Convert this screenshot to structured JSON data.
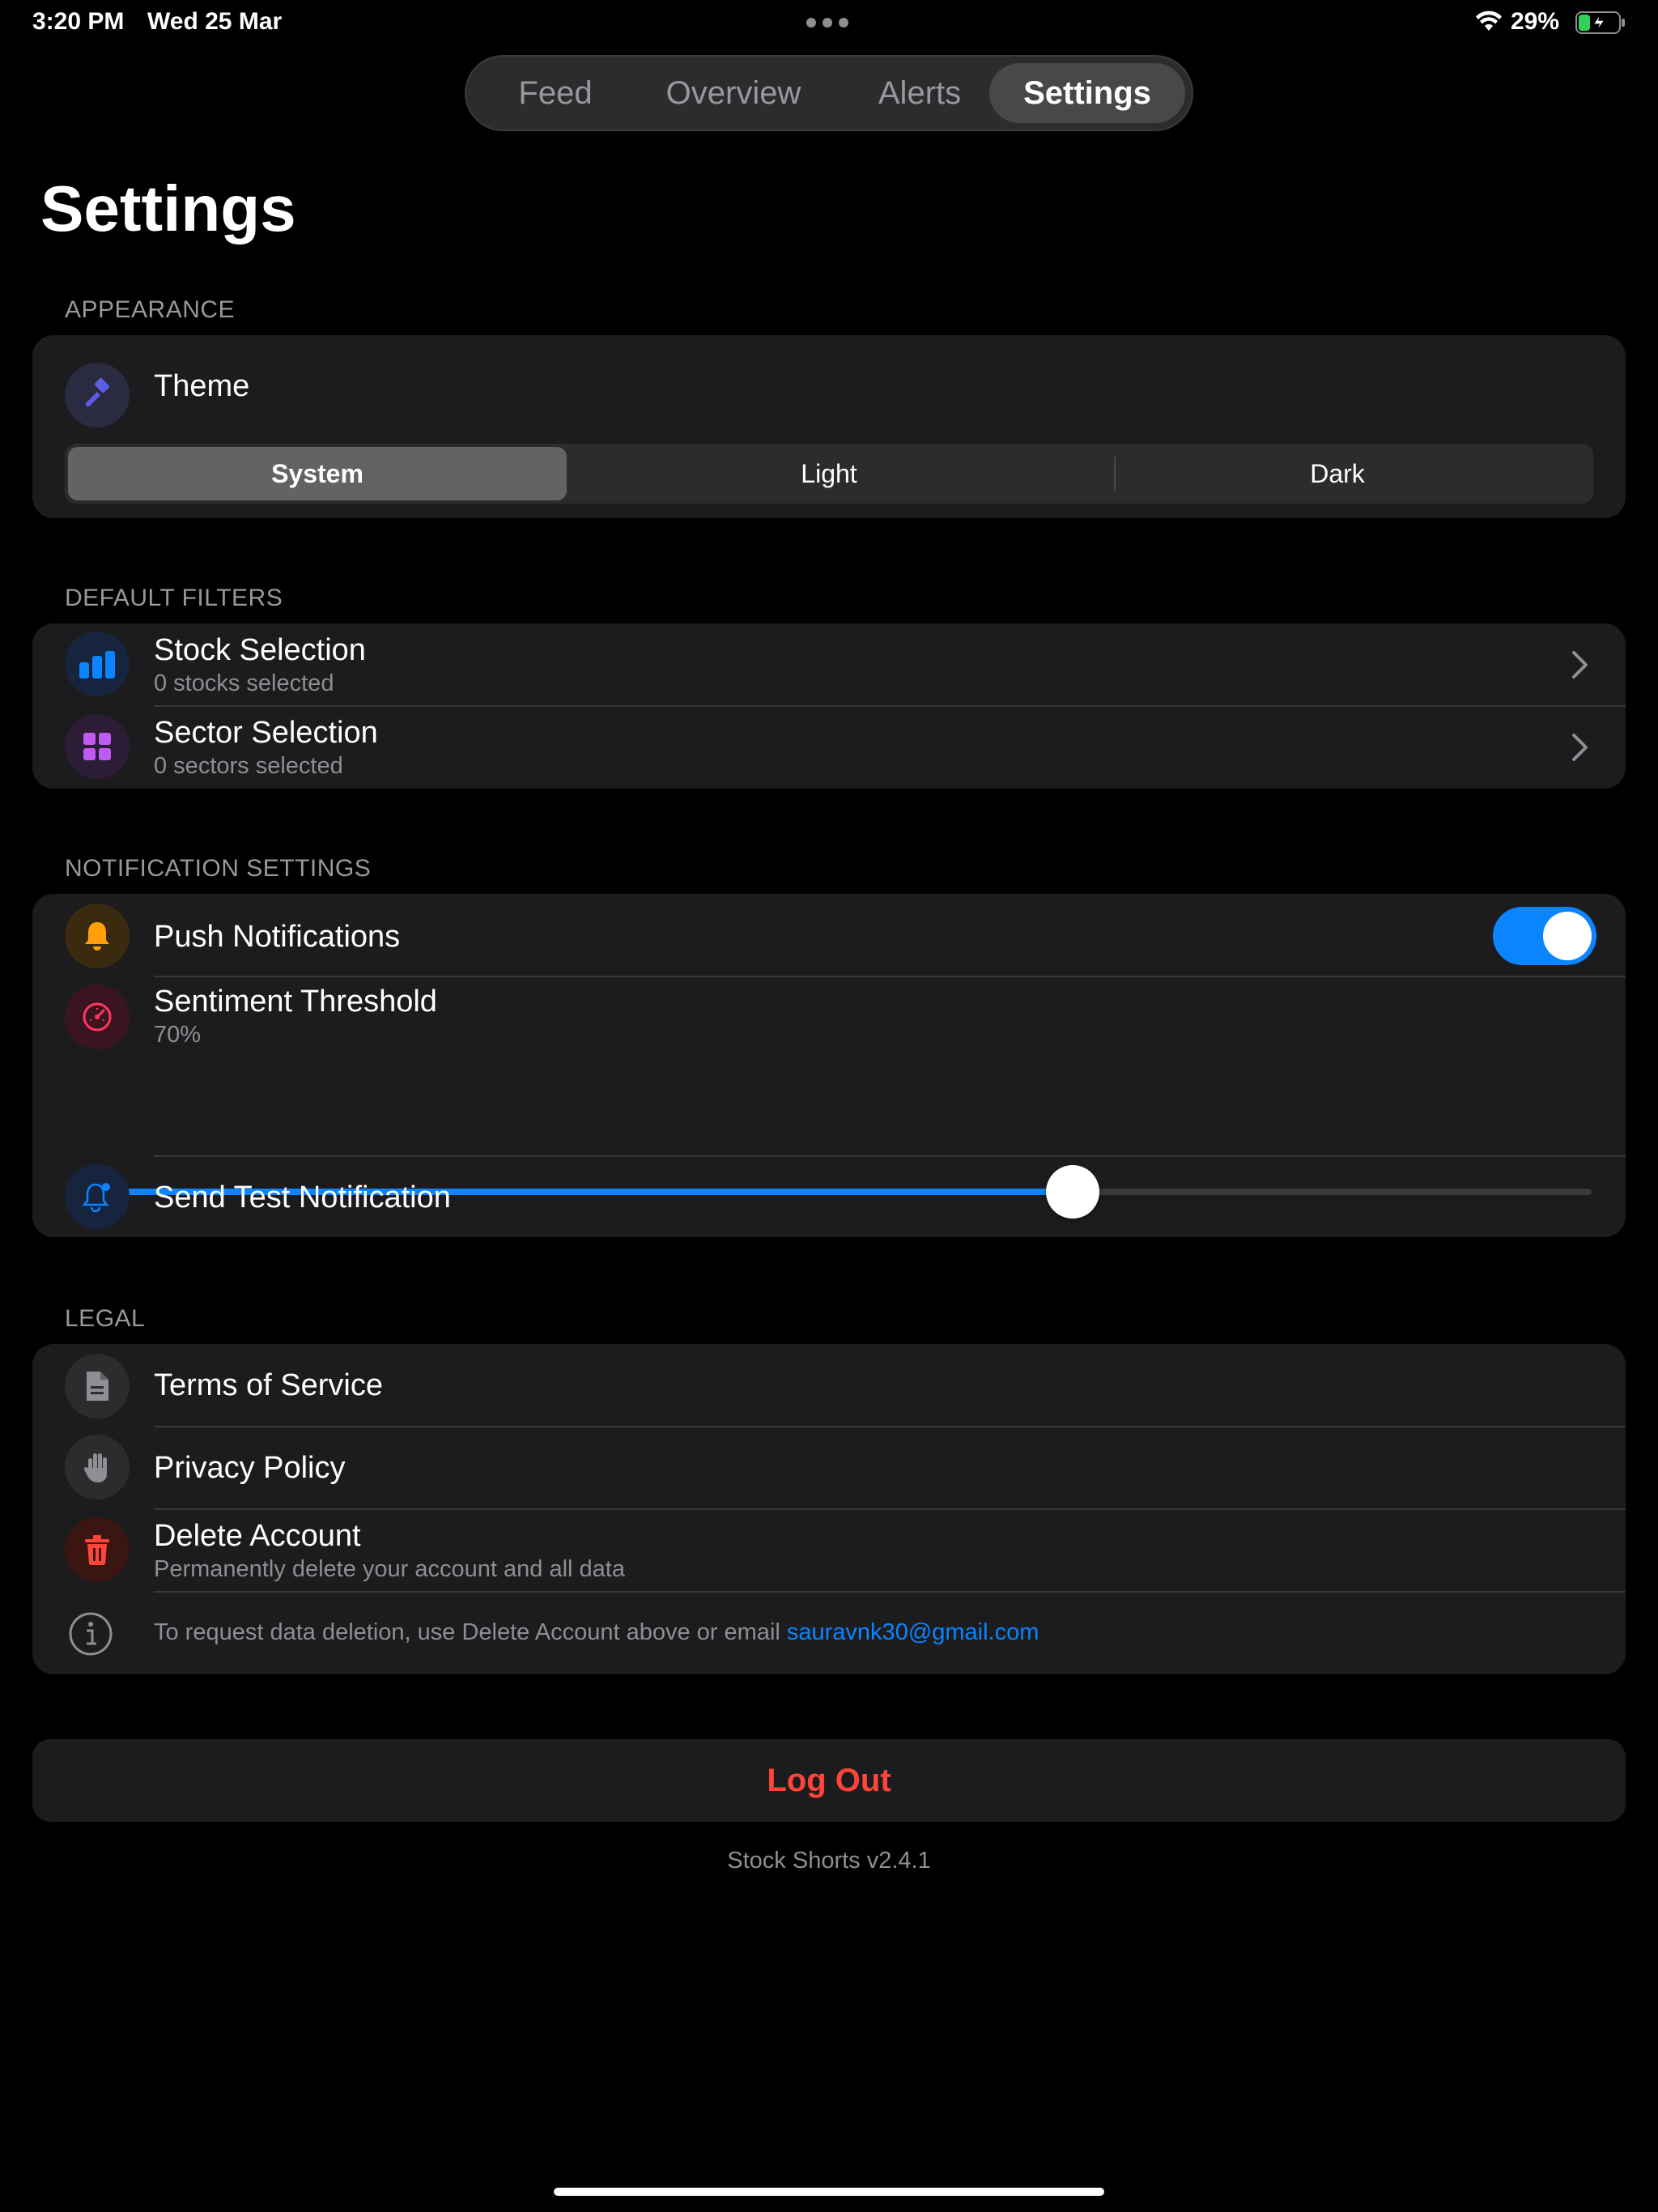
{
  "status_bar": {
    "time": "3:20 PM",
    "date": "Wed 25 Mar",
    "battery_percent": "29%",
    "battery_level": 0.29,
    "charging": true,
    "icons": [
      "wifi-icon",
      "battery-charging-icon",
      "multitasking-dots-icon"
    ]
  },
  "nav": {
    "tabs": [
      {
        "label": "Feed",
        "active": false
      },
      {
        "label": "Overview",
        "active": false
      },
      {
        "label": "Alerts",
        "active": false
      },
      {
        "label": "Settings",
        "active": true
      }
    ]
  },
  "page": {
    "title": "Settings"
  },
  "appearance": {
    "header": "APPEARANCE",
    "theme_label": "Theme",
    "theme_icon": "paintbrush-icon",
    "options": [
      "System",
      "Light",
      "Dark"
    ],
    "selected": "System"
  },
  "default_filters": {
    "header": "DEFAULT FILTERS",
    "stock": {
      "title": "Stock Selection",
      "subtitle": "0 stocks selected",
      "icon": "bar-chart-icon"
    },
    "sector": {
      "title": "Sector Selection",
      "subtitle": "0 sectors selected",
      "icon": "grid-icon"
    }
  },
  "notifications": {
    "header": "NOTIFICATION SETTINGS",
    "push": {
      "title": "Push Notifications",
      "enabled": true,
      "icon": "bell-icon"
    },
    "sentiment": {
      "title": "Sentiment Threshold",
      "value_label": "70%",
      "value": 0.66,
      "icon": "gauge-icon"
    },
    "test": {
      "title": "Send Test Notification",
      "icon": "bell-badge-icon"
    }
  },
  "legal": {
    "header": "LEGAL",
    "terms": {
      "title": "Terms of Service",
      "icon": "document-icon"
    },
    "privacy": {
      "title": "Privacy Policy",
      "icon": "hand-icon"
    },
    "delete": {
      "title": "Delete Account",
      "subtitle": "Permanently delete your account and all data",
      "icon": "trash-icon"
    },
    "info": {
      "text": "To request data deletion, use Delete Account above or email ",
      "email": "sauravnk30@gmail.com",
      "icon": "info-icon"
    }
  },
  "logout_label": "Log Out",
  "version": "Stock Shorts v2.4.1",
  "colors": {
    "accent": "#0a84ff",
    "destructive": "#ff453a",
    "theme_icon": "#5e5ce6",
    "bell_icon": "#ff9f0a",
    "sector_icon": "#bf5af2",
    "gauge_icon": "#ff375f"
  }
}
